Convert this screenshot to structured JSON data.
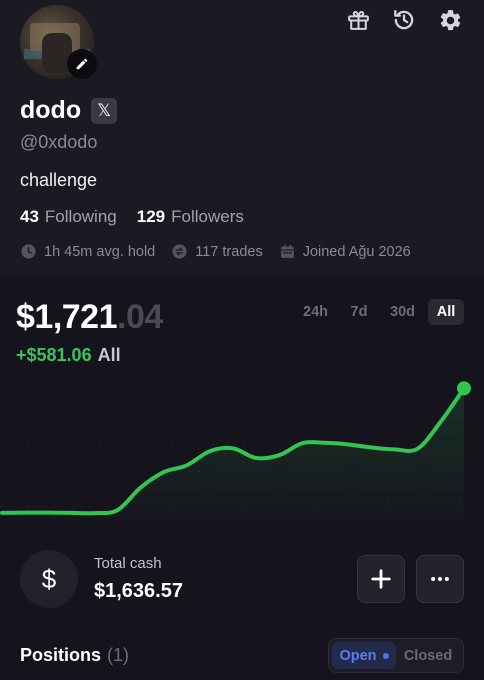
{
  "profile": {
    "name": "dodo",
    "x_badge": "𝕏",
    "handle": "@0xdodo",
    "bio": "challenge",
    "following_count": "43",
    "following_label": "Following",
    "followers_count": "129",
    "followers_label": "Followers",
    "avg_hold": "1h 45m avg. hold",
    "trades": "117 trades",
    "joined": "Joined Ağu 2026"
  },
  "top_icons": [
    "gift-icon",
    "history-icon",
    "gear-icon"
  ],
  "portfolio": {
    "balance_main": "$1,721",
    "balance_cents": ".04",
    "pnl": "+$581.06",
    "pnl_period": "All",
    "ranges": [
      "24h",
      "7d",
      "30d",
      "All"
    ],
    "active_range": "All"
  },
  "chart_data": {
    "type": "line",
    "x": [
      0,
      2,
      4,
      6,
      8,
      10,
      12,
      14,
      16,
      18,
      20,
      22,
      24,
      26,
      28,
      30,
      32,
      34,
      36,
      38,
      40
    ],
    "y": [
      1140,
      1141,
      1141,
      1140,
      1139,
      1153,
      1258,
      1330,
      1362,
      1428,
      1441,
      1396,
      1409,
      1465,
      1467,
      1459,
      1445,
      1436,
      1440,
      1567,
      1721
    ],
    "series_color": "#32c552",
    "xlim": [
      0,
      40
    ],
    "ylim": [
      1060,
      1760
    ]
  },
  "cash": {
    "icon": "$",
    "label": "Total cash",
    "value": "$1,636.57"
  },
  "actions": {
    "add": "+",
    "more": "•••"
  },
  "positions": {
    "title": "Positions",
    "count": "(1)",
    "tab_open": "Open",
    "tab_closed": "Closed"
  },
  "colors": {
    "background": "#15141d",
    "accent_green": "#39c659",
    "accent_blue": "#5b7cf0"
  }
}
